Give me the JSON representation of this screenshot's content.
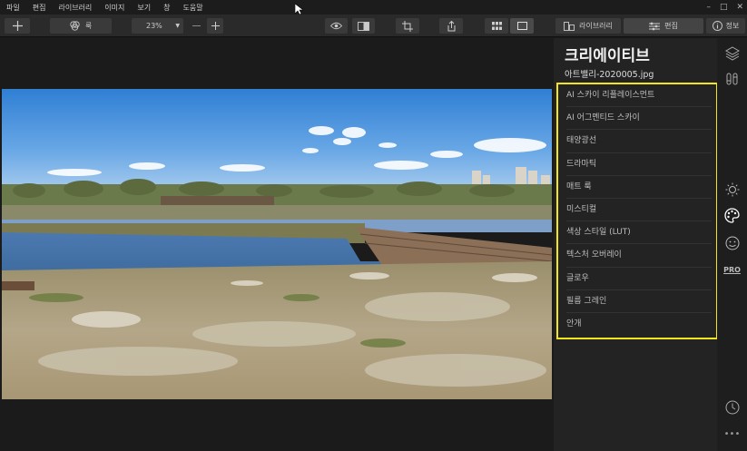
{
  "menu": [
    "파일",
    "편집",
    "라이브러리",
    "이미지",
    "보기",
    "창",
    "도움말"
  ],
  "toolbar": {
    "looks_label": "룩",
    "zoom_value": "23%",
    "library_tab": "라이브러리",
    "edit_tab": "편집",
    "info_tab": "정보"
  },
  "panel": {
    "title": "크리에이티브",
    "filename": "아트밸리-2020005.jpg",
    "filters": [
      "AI 스카이 리플레이스먼트",
      "AI 어그멘티드 스카이",
      "태양광선",
      "드라마틱",
      "매트 룩",
      "미스티컬",
      "색상 스타일 (LUT)",
      "텍스처 오버레이",
      "글로우",
      "필름 그레인",
      "안개"
    ]
  },
  "rail": {
    "pro_label": "PRO"
  },
  "colors": {
    "highlight": "#f5e51b",
    "panel_bg": "#232323",
    "toolbar_bg": "#2a2a2a"
  }
}
